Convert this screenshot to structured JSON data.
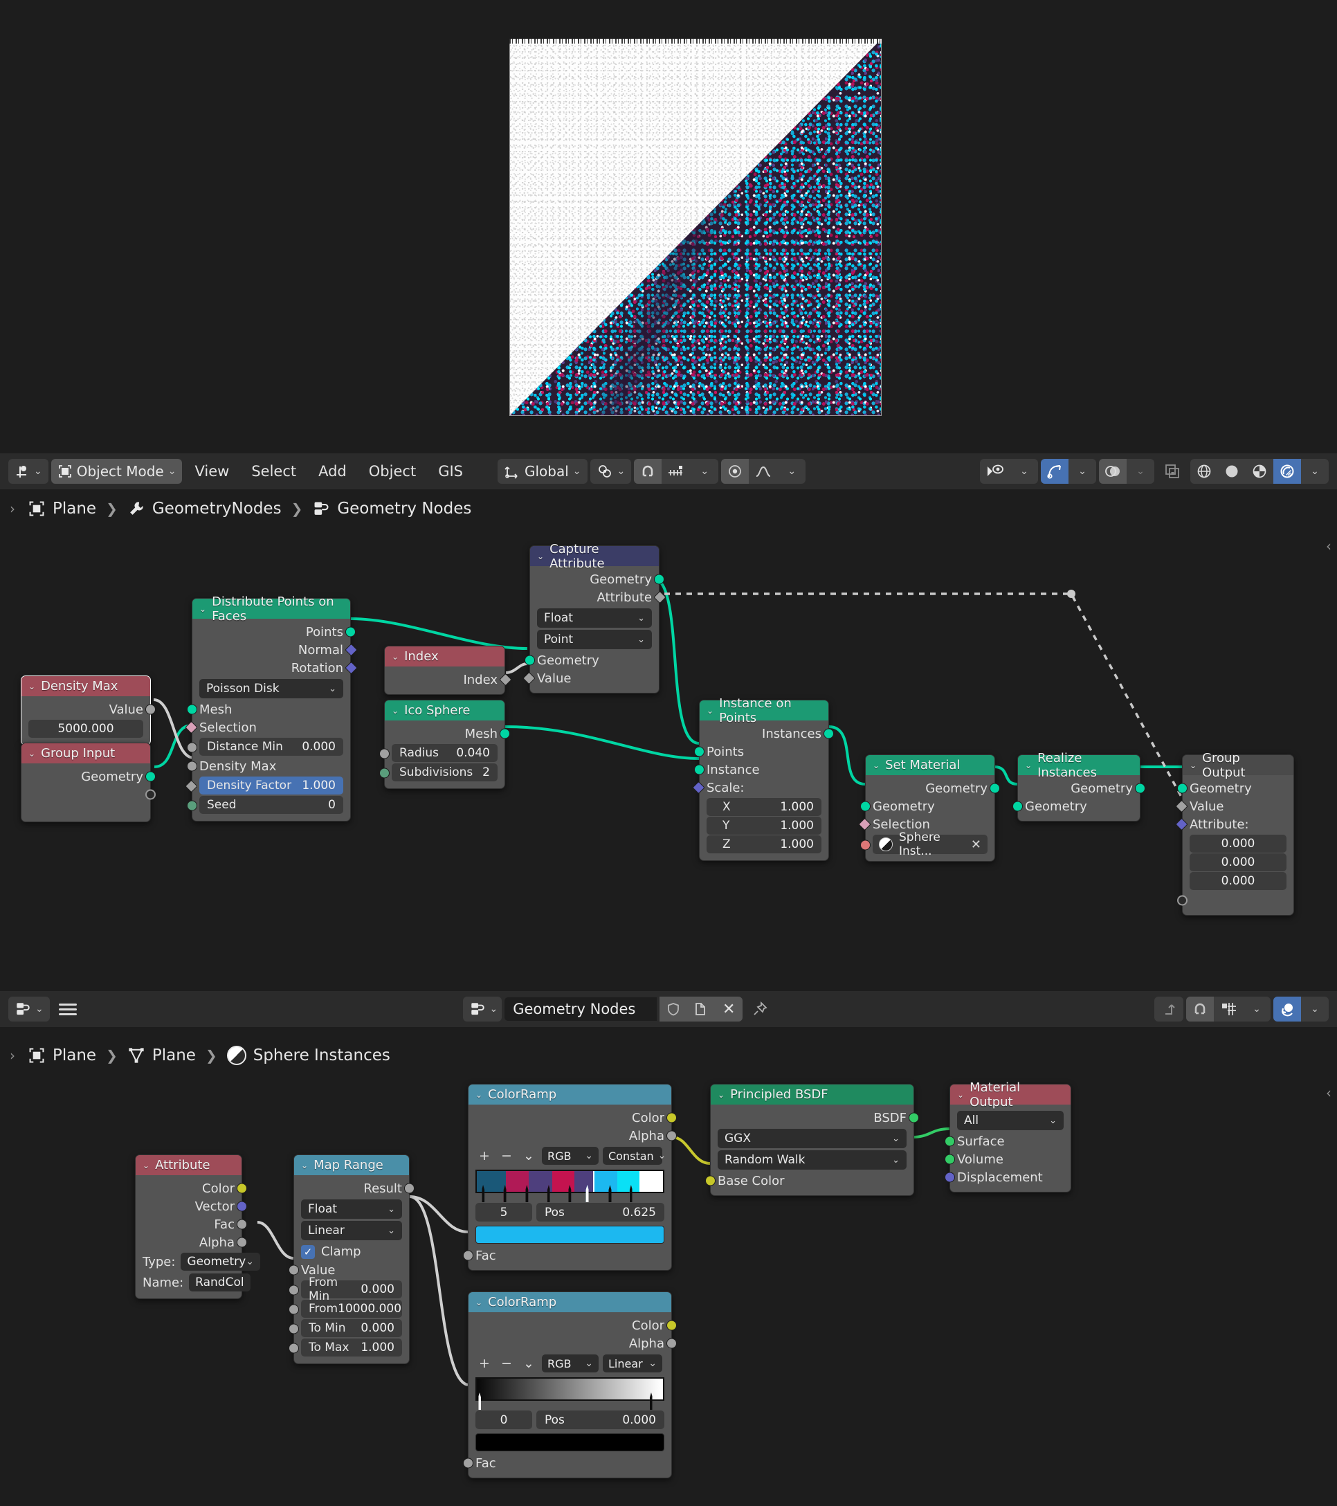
{
  "viewport": {
    "header": {
      "editor_type_icon": "geometry-nodes-editor-icon",
      "mode": "Object Mode",
      "mode_icon": "object-mode-icon",
      "menus": [
        "View",
        "Select",
        "Add",
        "Object",
        "GIS"
      ],
      "transform_orientation": "Global",
      "transform_orientation_icon": "orientation-axis-icon",
      "pivot_icon": "pivot-point-icon",
      "snap_icon": "magnet-icon",
      "snap_target_icon": "snap-increment-icon",
      "proportional_icon": "proportional-edit-icon",
      "falloff_icon": "smooth-falloff-icon",
      "visibility_icon": "show-hide-icon",
      "gizmo_icon": "gizmo-icon",
      "overlays_icon": "overlays-icon",
      "xray_icon": "xray-toggle-icon",
      "shading_modes": [
        "wireframe-shading-icon",
        "solid-shading-icon",
        "material-preview-shading-icon",
        "rendered-shading-icon"
      ],
      "shading_active": "rendered-shading-icon"
    }
  },
  "geometry_nodes_editor": {
    "breadcrumb": [
      {
        "icon": "object-icon",
        "label": "Plane"
      },
      {
        "icon": "modifier-wrench-icon",
        "label": "GeometryNodes"
      },
      {
        "icon": "geometry-nodes-icon",
        "label": "Geometry Nodes"
      }
    ],
    "nodes": {
      "density_max": {
        "title": "Density Max",
        "output": "Value",
        "value": "5000.000"
      },
      "group_input": {
        "title": "Group Input",
        "output": "Geometry"
      },
      "distribute": {
        "title": "Distribute Points on Faces",
        "outputs": [
          "Points",
          "Normal",
          "Rotation"
        ],
        "method": "Poisson Disk",
        "inputs": [
          "Mesh",
          "Selection"
        ],
        "fields": [
          {
            "label": "Distance Min",
            "value": "0.000"
          },
          {
            "label": "Density Max",
            "value": ""
          },
          {
            "label": "Density Factor",
            "value": "1.000"
          },
          {
            "label": "Seed",
            "value": "0"
          }
        ]
      },
      "index": {
        "title": "Index",
        "output": "Index"
      },
      "ico_sphere": {
        "title": "Ico Sphere",
        "output": "Mesh",
        "fields": [
          {
            "label": "Radius",
            "value": "0.040"
          },
          {
            "label": "Subdivisions",
            "value": "2"
          }
        ]
      },
      "capture_attribute": {
        "title": "Capture Attribute",
        "outputs": [
          "Geometry",
          "Attribute"
        ],
        "data_type": "Float",
        "domain": "Point",
        "inputs": [
          "Geometry",
          "Value"
        ]
      },
      "instance_on_points": {
        "title": "Instance on Points",
        "output": "Instances",
        "inputs": [
          "Points",
          "Instance",
          "Scale:"
        ],
        "scale": [
          {
            "axis": "X",
            "value": "1.000"
          },
          {
            "axis": "Y",
            "value": "1.000"
          },
          {
            "axis": "Z",
            "value": "1.000"
          }
        ]
      },
      "set_material": {
        "title": "Set Material",
        "output": "Geometry",
        "inputs": [
          "Geometry",
          "Selection"
        ],
        "material": "Sphere Inst...",
        "material_icon": "material-ball-icon",
        "clear_icon": "close-icon"
      },
      "realize_instances": {
        "title": "Realize Instances",
        "output": "Geometry",
        "input": "Geometry"
      },
      "group_output": {
        "title": "Group Output",
        "inputs": [
          "Geometry",
          "Value",
          "Attribute:"
        ],
        "attribute": [
          "0.000",
          "0.000",
          "0.000"
        ]
      }
    }
  },
  "shader_editor": {
    "header": {
      "editor_type_icon": "shader-editor-icon",
      "menu_icon": "hamburger-menu-icon",
      "id_icon": "geometry-nodes-icon",
      "name": "Geometry Nodes",
      "shield_icon": "fake-user-icon",
      "copy_icon": "new-copy-icon",
      "close_icon": "unlink-icon",
      "pin_icon": "pin-icon",
      "parent_icon": "go-to-parent-icon",
      "snap_icon": "magnet-icon",
      "snap_node_icon": "snap-node-icon",
      "overlay_icon": "node-overlay-icon"
    },
    "breadcrumb": [
      {
        "icon": "object-icon",
        "label": "Plane"
      },
      {
        "icon": "mesh-data-icon",
        "label": "Plane"
      },
      {
        "icon": "material-ball-icon",
        "label": "Sphere Instances"
      }
    ],
    "nodes": {
      "attribute": {
        "title": "Attribute",
        "outputs": [
          "Color",
          "Vector",
          "Fac",
          "Alpha"
        ],
        "type_label": "Type:",
        "type_value": "Geometry",
        "name_label": "Name:",
        "name_value": "RandCol"
      },
      "map_range": {
        "title": "Map Range",
        "output": "Result",
        "data_type": "Float",
        "interpolation": "Linear",
        "clamp_label": "Clamp",
        "clamp_checked": true,
        "value_label": "Value",
        "fields": [
          {
            "label": "From Min",
            "value": "0.000"
          },
          {
            "label": "From",
            "value": "10000.000"
          },
          {
            "label": "To Min",
            "value": "0.000"
          },
          {
            "label": "To Max",
            "value": "1.000"
          }
        ]
      },
      "colorramp_top": {
        "title": "ColorRamp",
        "outputs": [
          "Color",
          "Alpha"
        ],
        "add_icon": "plus-icon",
        "remove_icon": "minus-icon",
        "menu_icon": "chevron-down-icon",
        "color_mode": "RGB",
        "interpolation": "Constan",
        "index": "5",
        "pos_label": "Pos",
        "pos_value": "0.625",
        "selected_color": "#1cb8f0",
        "cursor_pos": 0.625,
        "stops": [
          {
            "pos": 0.03,
            "color": "#1a5878"
          },
          {
            "pos": 0.155,
            "color": "#b01a56"
          },
          {
            "pos": 0.28,
            "color": "#4e3f7d"
          },
          {
            "pos": 0.405,
            "color": "#c4134f"
          },
          {
            "pos": 0.525,
            "color": "#4e3f7d"
          },
          {
            "pos": 0.625,
            "color": "#1cb8f0"
          },
          {
            "pos": 0.755,
            "color": "#0ae0f5"
          },
          {
            "pos": 0.875,
            "color": "#ffffff"
          }
        ],
        "input": "Fac"
      },
      "colorramp_bottom": {
        "title": "ColorRamp",
        "outputs": [
          "Color",
          "Alpha"
        ],
        "color_mode": "RGB",
        "interpolation": "Linear",
        "index": "0",
        "pos_label": "Pos",
        "pos_value": "0.000",
        "selected_color": "#000000",
        "stops": [
          {
            "pos": 0.01,
            "color": "#0a0a0a"
          },
          {
            "pos": 0.99,
            "color": "#ffffff"
          }
        ],
        "input": "Fac"
      },
      "principled_bsdf": {
        "title": "Principled BSDF",
        "output": "BSDF",
        "distribution": "GGX",
        "subsurface_method": "Random Walk",
        "base_color_label": "Base Color"
      },
      "material_output": {
        "title": "Material Output",
        "target": "All",
        "inputs": [
          "Surface",
          "Volume",
          "Displacement"
        ]
      }
    }
  },
  "colors": {
    "accent_blue": "#4772b3",
    "geometry_socket": "#00d6a3",
    "node_geo_header": "#1c9a73",
    "node_input_header": "#9e4c58",
    "node_attr_header": "#3b3d66",
    "node_converter_header": "#4a8fa8",
    "node_shader_header": "#1f8a5f"
  }
}
